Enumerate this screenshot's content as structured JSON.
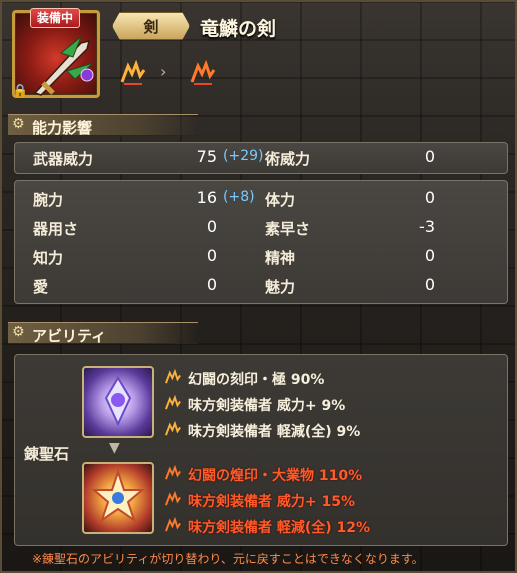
{
  "header": {
    "equip_badge": "装備中",
    "category": "剣",
    "item_name": "竜鱗の剣",
    "lock_icon": "lock-icon",
    "rank_icons": [
      "rank-icon-current",
      "rank-icon-next"
    ]
  },
  "sections": {
    "stats_title": "能力影響",
    "ability_title": "アビリティ"
  },
  "stats": {
    "weapon_power": {
      "label": "武器威力",
      "value": "75",
      "bonus": "(+29)"
    },
    "art_power": {
      "label": "術威力",
      "value": "0"
    },
    "rows": [
      {
        "left_label": "腕力",
        "left_value": "16",
        "left_bonus": "(+8)",
        "right_label": "体力",
        "right_value": "0"
      },
      {
        "left_label": "器用さ",
        "left_value": "0",
        "left_bonus": "",
        "right_label": "素早さ",
        "right_value": "-3"
      },
      {
        "left_label": "知力",
        "left_value": "0",
        "left_bonus": "",
        "right_label": "精神",
        "right_value": "0"
      },
      {
        "left_label": "愛",
        "left_value": "0",
        "left_bonus": "",
        "right_label": "魅力",
        "right_value": "0"
      }
    ]
  },
  "abilities": {
    "stone_label": "錬聖石",
    "current": [
      "幻闘の刻印・極 90%",
      "味方剣装備者 威力+ 9%",
      "味方剣装備者 軽減(全) 9%"
    ],
    "next": [
      "幻闘の煌印・大業物 110%",
      "味方剣装備者 威力+ 15%",
      "味方剣装備者 軽減(全) 12%"
    ]
  },
  "note": "※錬聖石のアビリティが切り替わり、元に戻すことはできなくなります。",
  "colors": {
    "bonus": "#79c9ff",
    "upgrade": "#ff5a2a",
    "note": "#ff8a4a",
    "gold": "#c79a3c"
  }
}
